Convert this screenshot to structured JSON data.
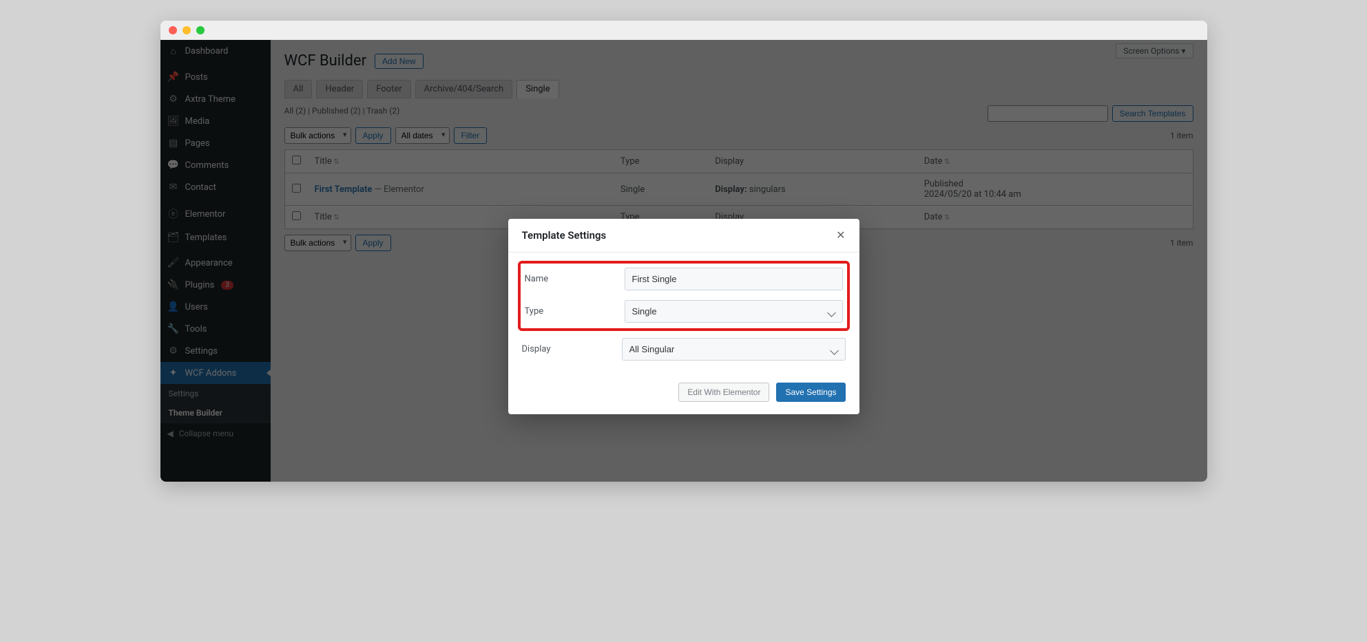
{
  "sidebar": {
    "items": [
      {
        "icon": "⌂",
        "label": "Dashboard"
      },
      {
        "icon": "📌",
        "label": "Posts"
      },
      {
        "icon": "⚙",
        "label": "Axtra Theme"
      },
      {
        "icon": "🖼",
        "label": "Media"
      },
      {
        "icon": "▤",
        "label": "Pages"
      },
      {
        "icon": "💬",
        "label": "Comments"
      },
      {
        "icon": "✉",
        "label": "Contact"
      },
      {
        "icon": "ⓔ",
        "label": "Elementor"
      },
      {
        "icon": "🗂",
        "label": "Templates"
      },
      {
        "icon": "🖌",
        "label": "Appearance"
      },
      {
        "icon": "🔌",
        "label": "Plugins",
        "badge": "3"
      },
      {
        "icon": "👤",
        "label": "Users"
      },
      {
        "icon": "🔧",
        "label": "Tools"
      },
      {
        "icon": "⚙",
        "label": "Settings"
      },
      {
        "icon": "✦",
        "label": "WCF Addons"
      }
    ],
    "sub": [
      {
        "label": "Settings"
      },
      {
        "label": "Theme Builder"
      }
    ],
    "collapse": "Collapse menu"
  },
  "header": {
    "screen_options": "Screen Options ▾",
    "title": "WCF Builder",
    "add_new": "Add New"
  },
  "tabs": [
    "All",
    "Header",
    "Footer",
    "Archive/404/Search",
    "Single"
  ],
  "subsubsub": "All (2)  |  Published (2)  |  Trash (2)",
  "bulk": {
    "select": "Bulk actions",
    "apply": "Apply",
    "dates": "All dates",
    "filter": "Filter"
  },
  "search": {
    "button": "Search Templates"
  },
  "count": "1 item",
  "table": {
    "cols": {
      "title": "Title",
      "type": "Type",
      "display": "Display",
      "date": "Date"
    },
    "rows": [
      {
        "title": "First Template",
        "suffix": " — Elementor",
        "type": "Single",
        "display_label": "Display:",
        "display": "singulars",
        "date_status": "Published",
        "date": "2024/05/20 at 10:44 am"
      }
    ]
  },
  "modal": {
    "title": "Template Settings",
    "name_label": "Name",
    "name_value": "First Single",
    "type_label": "Type",
    "type_value": "Single",
    "display_label": "Display",
    "display_value": "All Singular",
    "edit_btn": "Edit With Elementor",
    "save_btn": "Save Settings"
  }
}
